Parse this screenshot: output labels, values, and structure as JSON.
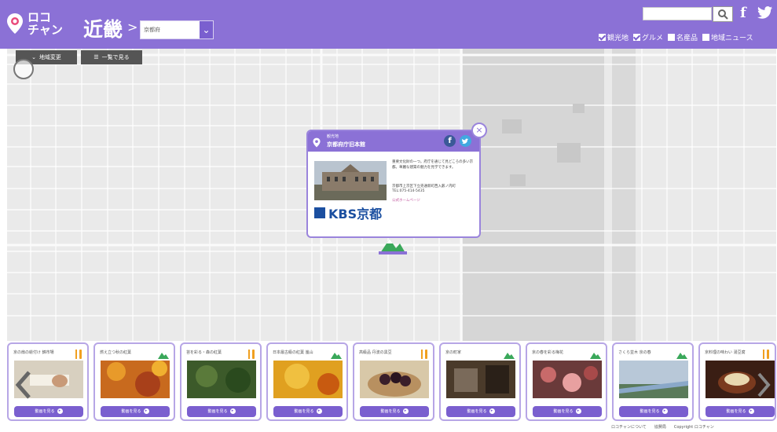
{
  "header": {
    "logo_line1": "ロコ",
    "logo_line2": "チャン",
    "region": "近畿",
    "separator": ">",
    "prefecture": "京都府"
  },
  "filters": [
    {
      "label": "観光地",
      "checked": true
    },
    {
      "label": "グルメ",
      "checked": true
    },
    {
      "label": "名産品",
      "checked": false
    },
    {
      "label": "地域ニュース",
      "checked": false
    }
  ],
  "map_controls": {
    "region_change": "地域変更",
    "list_view": "一覧で見る"
  },
  "popup": {
    "category": "観光地",
    "title": "京都府庁旧本館",
    "description": "重要文化財の一つ。府庁を通じて見どころの多い京都。華麗な建築の魅力を見学できます。",
    "address": "京都市上京区下立売通新町西入薮ノ内町",
    "tel": "TEL:075-414-5435",
    "link": "公式ホームページ",
    "broadcaster": "KBS京都",
    "close": "×"
  },
  "cards": [
    {
      "title": "京の扇の絵付け 錦市場",
      "button": "動画を見る",
      "category": "グルメ"
    },
    {
      "title": "燃え立つ秋の紅葉",
      "button": "動画を見る",
      "category": "観光地"
    },
    {
      "title": "苔を彩る・森の紅葉",
      "button": "動画を見る",
      "category": "グルメ"
    },
    {
      "title": "日本最古級の紅葉 嵐山",
      "button": "動画を見る",
      "category": "観光地"
    },
    {
      "title": "高級品 丹波の黒豆",
      "button": "動画を見る",
      "category": "グルメ"
    },
    {
      "title": "京の町家",
      "button": "動画を見る",
      "category": "観光地"
    },
    {
      "title": "京の春を彩る梅花",
      "button": "動画を見る",
      "category": "観光地"
    },
    {
      "title": "さくら並木 京の春",
      "button": "動画を見る",
      "category": "観光地"
    },
    {
      "title": "京料理の味わい 湯豆腐",
      "button": "動画を見る",
      "category": "グルメ"
    }
  ],
  "footer": {
    "about": "ロコチャンについて",
    "stations": "協賛局",
    "copyright": "Copyright ロコチャン"
  },
  "colors": {
    "brand": "#8b71d6",
    "accent": "#7a5fcf"
  }
}
